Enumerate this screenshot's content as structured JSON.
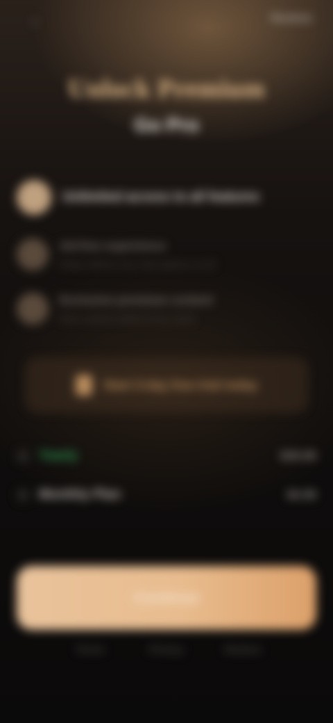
{
  "topbar": {
    "back_icon": "chevron-left-icon",
    "back_glyph": "‹",
    "restore_label": "Restore"
  },
  "header": {
    "title": "Unlock Premium",
    "subtitle": "Go Pro"
  },
  "features": [
    {
      "title": "Unlimited access to all features",
      "description": ""
    },
    {
      "title": "Ad-free experience",
      "description": "Enjoy without any interruptions at all"
    },
    {
      "title": "Exclusive premium content",
      "description": "New content added every week"
    }
  ],
  "trial": {
    "icon": "gift-icon",
    "text": "Start 3-day free trial today"
  },
  "plans": [
    {
      "name": "Yearly",
      "price": "$39.99",
      "highlight": "#2f9b55"
    },
    {
      "name": "Monthly Plan",
      "price": "$4.99"
    }
  ],
  "cta": {
    "label": "Continue"
  },
  "footer": {
    "terms": "Terms",
    "privacy": "Privacy",
    "restore": "Restore"
  },
  "colors": {
    "accent": "#e0b98a",
    "cta_start": "#e9c39c",
    "cta_end": "#dca06a",
    "background": "#0e0c0b"
  }
}
